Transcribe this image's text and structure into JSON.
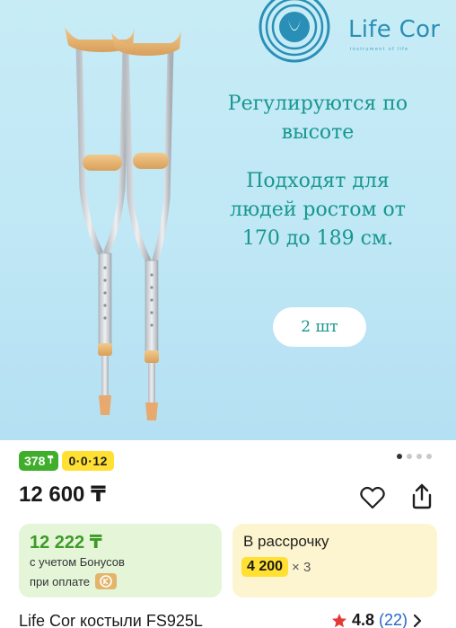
{
  "banner": {
    "brand": "Life Cor",
    "tagline": "instrument of life",
    "headline": "Регулируются по высоте",
    "subtext": "Подходят для людей ростом от 170 до 189 см.",
    "quantity_label": "2 шт",
    "background_color": "#bfe7f5",
    "text_color": "#17978f"
  },
  "badges": {
    "bonus": "378",
    "installment": "0·0·12"
  },
  "gallery": {
    "pages": 4,
    "active": 1
  },
  "price": {
    "value": "12 600 ₸"
  },
  "bonus_card": {
    "price": "12 222 ₸",
    "note_line1": "с учетом Бонусов",
    "note_line2": "при оплате",
    "payment_icon": "kaspi-icon",
    "color": "#3d9b27"
  },
  "installment_card": {
    "title": "В рассрочку",
    "amount": "4 200",
    "multiplier": "× 3",
    "highlight": "#ffe033"
  },
  "product": {
    "name": "Life Cor костыли FS925L",
    "rating": "4.8",
    "reviews": "(22)"
  },
  "icons": [
    "favorite-heart-icon",
    "share-icon",
    "star-icon",
    "chevron-right-icon"
  ]
}
